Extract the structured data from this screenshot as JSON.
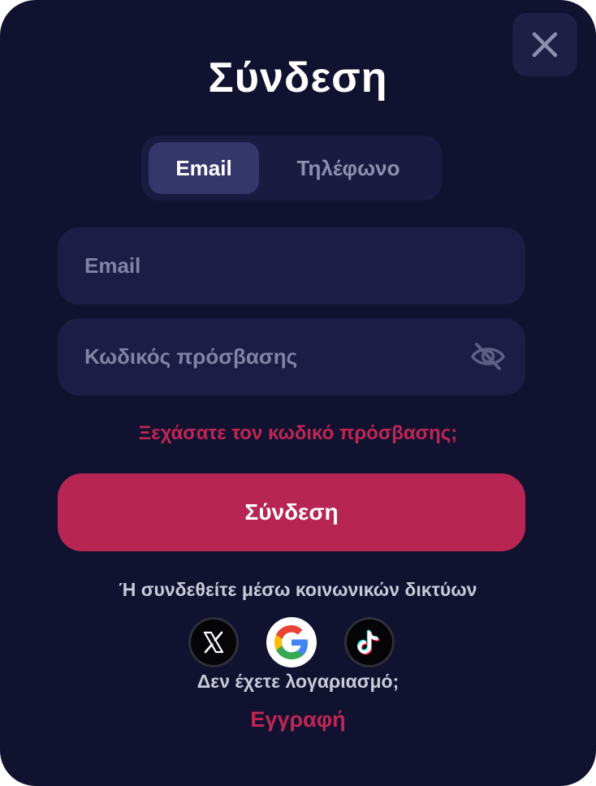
{
  "modal": {
    "title": "Σύνδεση",
    "close_icon": "close-icon"
  },
  "tabs": [
    {
      "label": "Email",
      "active": true
    },
    {
      "label": "Τηλέφωνο",
      "active": false
    }
  ],
  "form": {
    "email_placeholder": "Email",
    "password_placeholder": "Κωδικός πρόσβασης",
    "password_toggle_icon": "eye-off-icon",
    "forgot_link": "Ξεχάσατε τον κωδικό πρόσβασης;",
    "submit_label": "Σύνδεση"
  },
  "social": {
    "label": "Ή συνδεθείτε μέσω κοινωνικών δικτύων",
    "providers": [
      {
        "name": "X",
        "icon": "x-logo-icon"
      },
      {
        "name": "Google",
        "icon": "google-logo-icon"
      },
      {
        "name": "TikTok",
        "icon": "tiktok-logo-icon"
      }
    ]
  },
  "footer": {
    "no_account_text": "Δεν έχετε λογαριασμό;",
    "register_link": "Εγγραφή"
  },
  "colors": {
    "background": "#11122f",
    "field": "#1c1d44",
    "accent": "#b72553",
    "link": "#c02655"
  }
}
